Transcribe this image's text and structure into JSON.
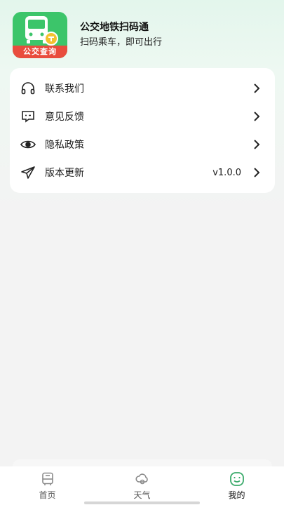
{
  "app": {
    "title": "公交地铁扫码通",
    "subtitle": "扫码乘车，即可出行",
    "icon_label": "公交查询",
    "icon_colors": {
      "bg": "#3cc56a",
      "label_bg": "#e94c3d"
    }
  },
  "menu": {
    "items": [
      {
        "label": "联系我们",
        "icon": "headphones-icon"
      },
      {
        "label": "意见反馈",
        "icon": "feedback-icon"
      },
      {
        "label": "隐私政策",
        "icon": "eye-icon"
      },
      {
        "label": "版本更新",
        "icon": "send-icon",
        "value": "v1.0.0"
      }
    ]
  },
  "tabbar": {
    "tabs": [
      {
        "label": "首页",
        "icon": "bus-icon",
        "active": false
      },
      {
        "label": "天气",
        "icon": "weather-icon",
        "active": false
      },
      {
        "label": "我的",
        "icon": "smile-icon",
        "active": true
      }
    ],
    "active_color": "#3aaa6a"
  }
}
